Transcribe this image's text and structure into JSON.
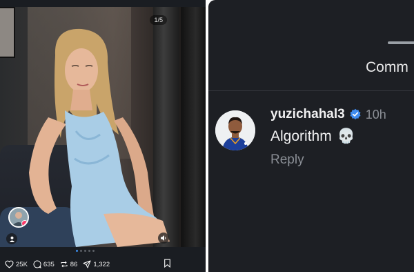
{
  "post": {
    "image_counter": "1/5",
    "likes": "25K",
    "comments": "635",
    "reposts": "86",
    "shares": "1,322",
    "carousel_dots": 5,
    "active_dot": 0
  },
  "comments_panel": {
    "tab_label": "Comm",
    "comment": {
      "username": "yuzichahal3",
      "verified": true,
      "time": "10h",
      "text": "Algorithm",
      "emoji": "💀",
      "reply_label": "Reply"
    }
  },
  "colors": {
    "verified_badge": "#3f8cf0",
    "jersey": "#1d3f9a",
    "accent_dot": "#3b8be8"
  }
}
